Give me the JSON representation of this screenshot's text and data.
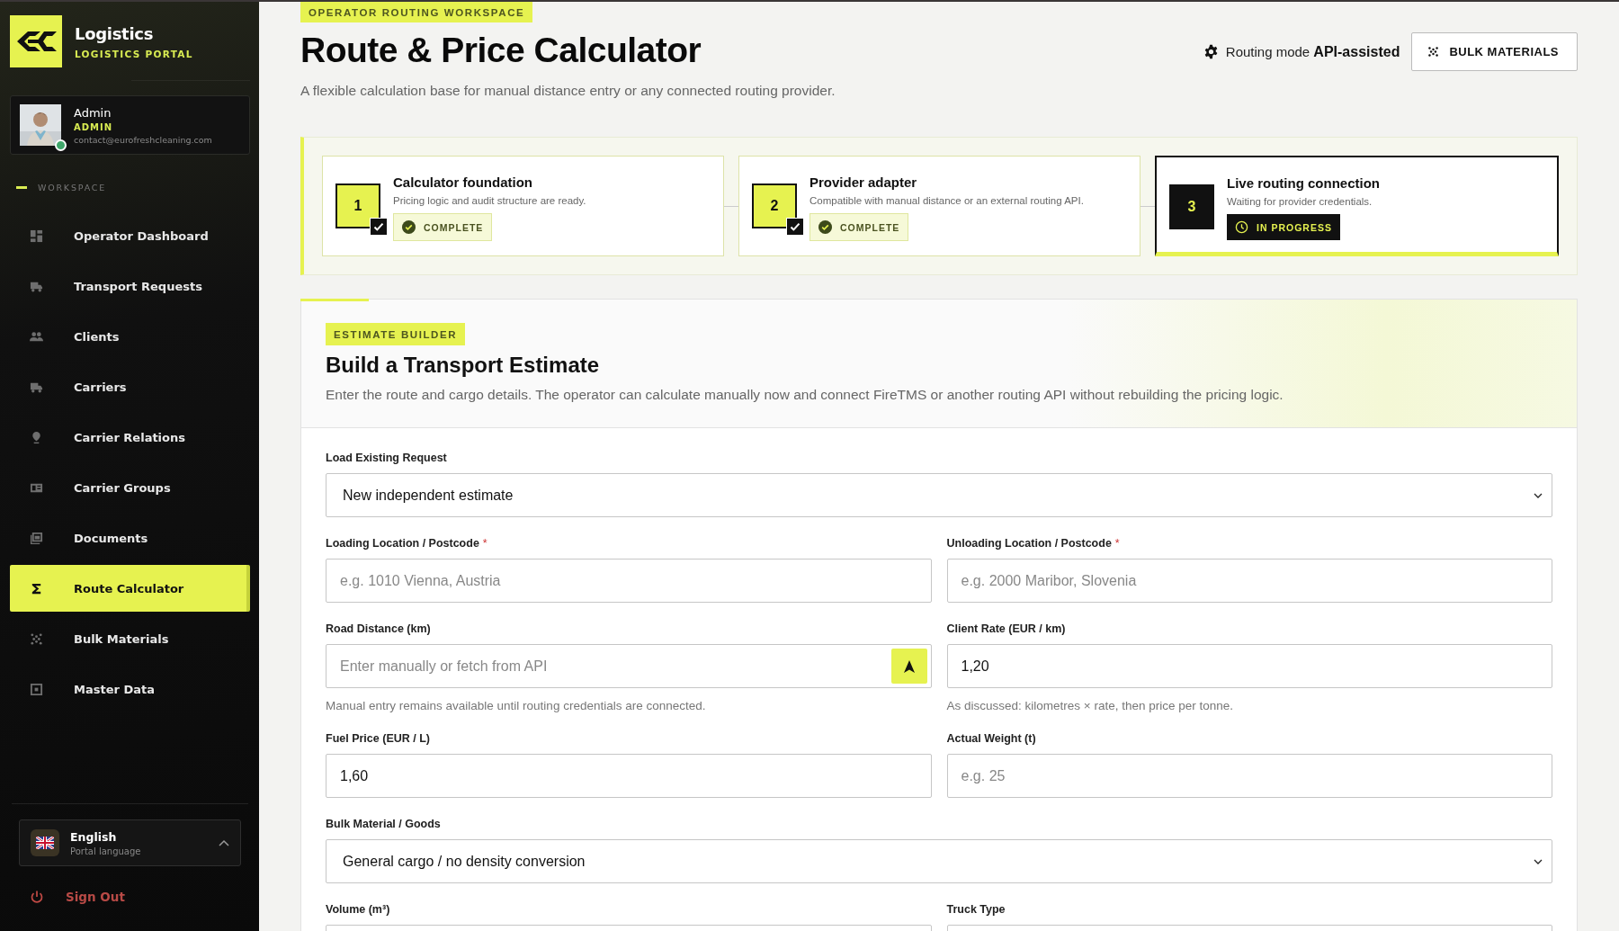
{
  "brand": {
    "title": "Logistics",
    "subtitle": "LOGISTICS PORTAL"
  },
  "profile": {
    "name": "Admin",
    "role": "ADMIN",
    "email": "contact@eurofreshcleaning.com",
    "online": true
  },
  "sidebar": {
    "section": "WORKSPACE",
    "items": [
      {
        "label": "Operator Dashboard",
        "kind": "dashboard",
        "selected": false
      },
      {
        "label": "Transport Requests",
        "kind": "truck",
        "selected": false
      },
      {
        "label": "Clients",
        "kind": "people",
        "selected": false
      },
      {
        "label": "Carriers",
        "kind": "truck",
        "selected": false
      },
      {
        "label": "Carrier Relations",
        "kind": "pin",
        "selected": false
      },
      {
        "label": "Carrier Groups",
        "kind": "card",
        "selected": false
      },
      {
        "label": "Documents",
        "kind": "docs",
        "selected": false
      },
      {
        "label": "Route Calculator",
        "kind": "sigma",
        "selected": true
      },
      {
        "label": "Bulk Materials",
        "kind": "dots",
        "selected": false
      },
      {
        "label": "Master Data",
        "kind": "box",
        "selected": false
      }
    ]
  },
  "language": {
    "label": "English",
    "caption": "Portal language"
  },
  "sign_out": "Sign Out",
  "header": {
    "eyebrow": "OPERATOR ROUTING WORKSPACE",
    "title": "Route & Price Calculator",
    "subtitle": "A flexible calculation base for manual distance entry or any connected routing provider.",
    "mode_label": "Routing mode",
    "mode_value": "API-assisted",
    "action": "BULK MATERIALS"
  },
  "steps": [
    {
      "number": "1",
      "title": "Calculator foundation",
      "description": "Pricing logic and audit structure are ready.",
      "status": "COMPLETE",
      "kind": "complete"
    },
    {
      "number": "2",
      "title": "Provider adapter",
      "description": "Compatible with manual distance or an external routing API.",
      "status": "COMPLETE",
      "kind": "complete"
    },
    {
      "number": "3",
      "title": "Live routing connection",
      "description": "Waiting for provider credentials.",
      "status": "IN PROGRESS",
      "kind": "in_progress"
    }
  ],
  "estimate": {
    "badge": "ESTIMATE BUILDER",
    "title": "Build a Transport Estimate",
    "description": "Enter the route and cargo details. The operator can calculate manually now and connect FireTMS or another routing API without rebuilding the pricing logic.",
    "rows": [
      [
        {
          "label": "Load Existing Request",
          "kind": "select",
          "value": "New independent estimate"
        }
      ],
      [
        {
          "label": "Loading Location / Postcode",
          "kind": "input",
          "placeholder": "e.g. 1010 Vienna, Austria",
          "required_mark": "*"
        },
        {
          "label": "Unloading Location / Postcode",
          "kind": "input",
          "placeholder": "e.g. 2000 Maribor, Slovenia",
          "required_mark": "*"
        }
      ],
      [
        {
          "label": "Road Distance (km)",
          "kind": "locate",
          "placeholder": "Enter manually or fetch from API",
          "hint": "Manual entry remains available until routing credentials are connected."
        },
        {
          "label": "Client Rate (EUR / km)",
          "kind": "input",
          "value": "1,20",
          "hint": "As discussed: kilometres × rate, then price per tonne."
        }
      ],
      [
        {
          "label": "Fuel Price (EUR / L)",
          "kind": "input",
          "value": "1,60"
        },
        {
          "label": "Actual Weight (t)",
          "kind": "input",
          "placeholder": "e.g. 25"
        }
      ],
      [
        {
          "label": "Bulk Material / Goods",
          "kind": "select",
          "value": "General cargo / no density conversion"
        }
      ],
      [
        {
          "label": "Volume (m³)",
          "kind": "input"
        },
        {
          "label": "Truck Type",
          "kind": "blank_select"
        }
      ]
    ]
  }
}
